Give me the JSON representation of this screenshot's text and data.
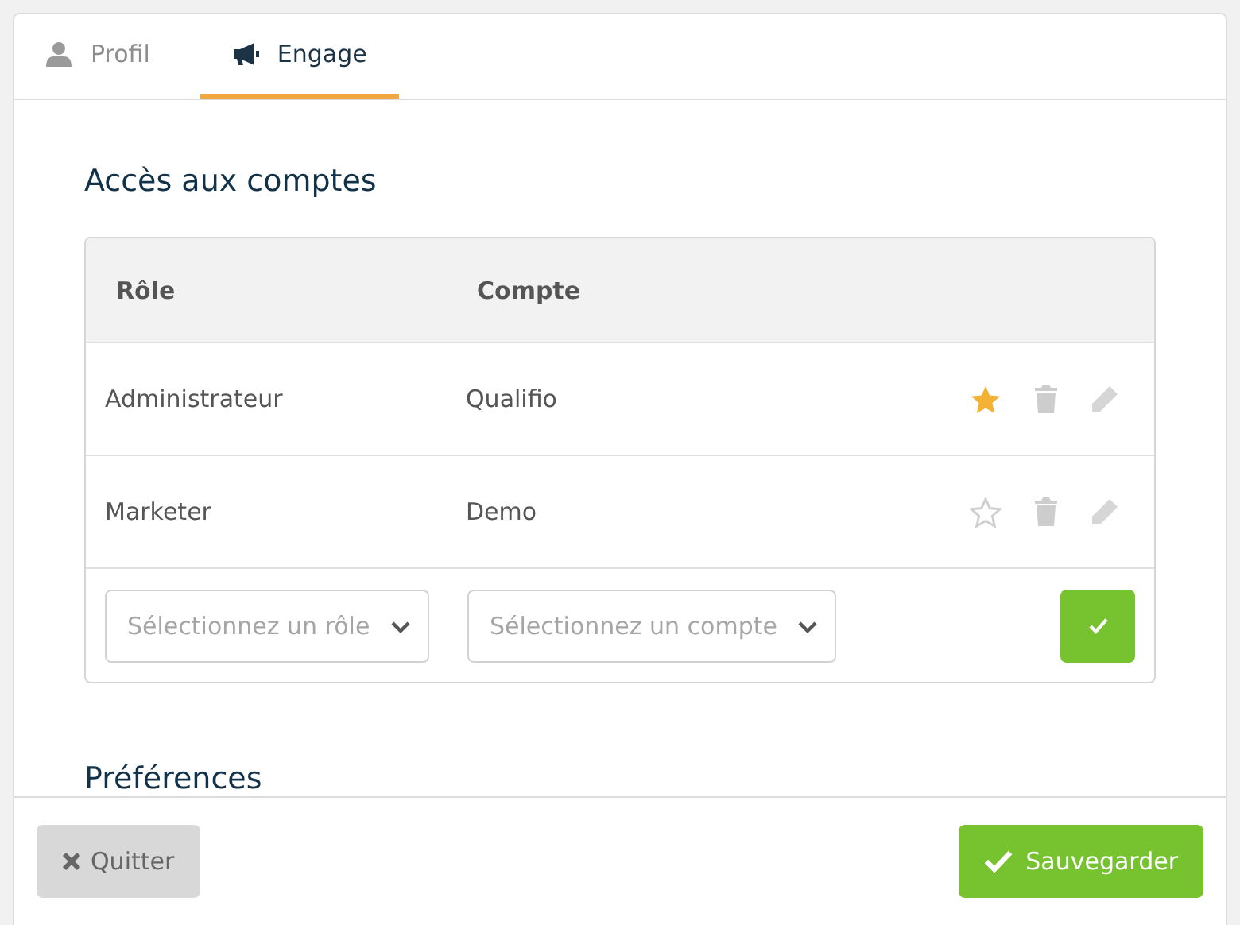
{
  "tabs": [
    {
      "label": "Profil",
      "selected": false
    },
    {
      "label": "Engage",
      "selected": true
    }
  ],
  "section_title": "Accès aux comptes",
  "table": {
    "columns": [
      "Rôle",
      "Compte"
    ],
    "rows": [
      {
        "role": "Administrateur",
        "account": "Qualifio",
        "favorite": true
      },
      {
        "role": "Marketer",
        "account": "Demo",
        "favorite": false
      }
    ],
    "new_row": {
      "role_placeholder": "Sélectionnez un rôle",
      "account_placeholder": "Sélectionnez un compte"
    }
  },
  "next_section_title": "Préférences",
  "footer": {
    "quit": "Quitter",
    "save": "Sauvegarder"
  }
}
